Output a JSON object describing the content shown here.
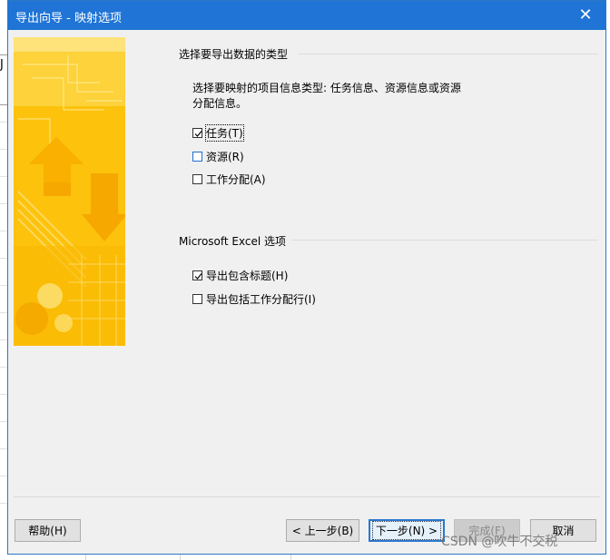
{
  "window": {
    "title": "导出向导 - 映射选项",
    "close_glyph": "✕"
  },
  "background": {
    "cell_text": "J"
  },
  "section_type": {
    "title": "选择要导出数据的类型",
    "description_line1": "选择要映射的项目信息类型: 任务信息、资源信息或资源",
    "description_line2": "分配信息。",
    "options": [
      {
        "label": "任务(T)",
        "checked": true
      },
      {
        "label": "资源(R)",
        "checked": false
      },
      {
        "label": "工作分配(A)",
        "checked": false
      }
    ]
  },
  "section_excel": {
    "title": "Microsoft Excel 选项",
    "options": [
      {
        "label": "导出包含标题(H)",
        "checked": true
      },
      {
        "label": "导出包括工作分配行(I)",
        "checked": false
      }
    ]
  },
  "footer": {
    "help_label": "帮助(H)",
    "back_label": "< 上一步(B)",
    "next_label": "下一步(N) >",
    "finish_label": "完成(F)",
    "cancel_label": "取消"
  },
  "watermark": "CSDN @吹牛不交税",
  "colors": {
    "titlebar": "#1f74d5",
    "dialog_bg": "#f0f0f0",
    "banner_yellow": "#fcc20c",
    "focus_border": "#2b77d1"
  }
}
